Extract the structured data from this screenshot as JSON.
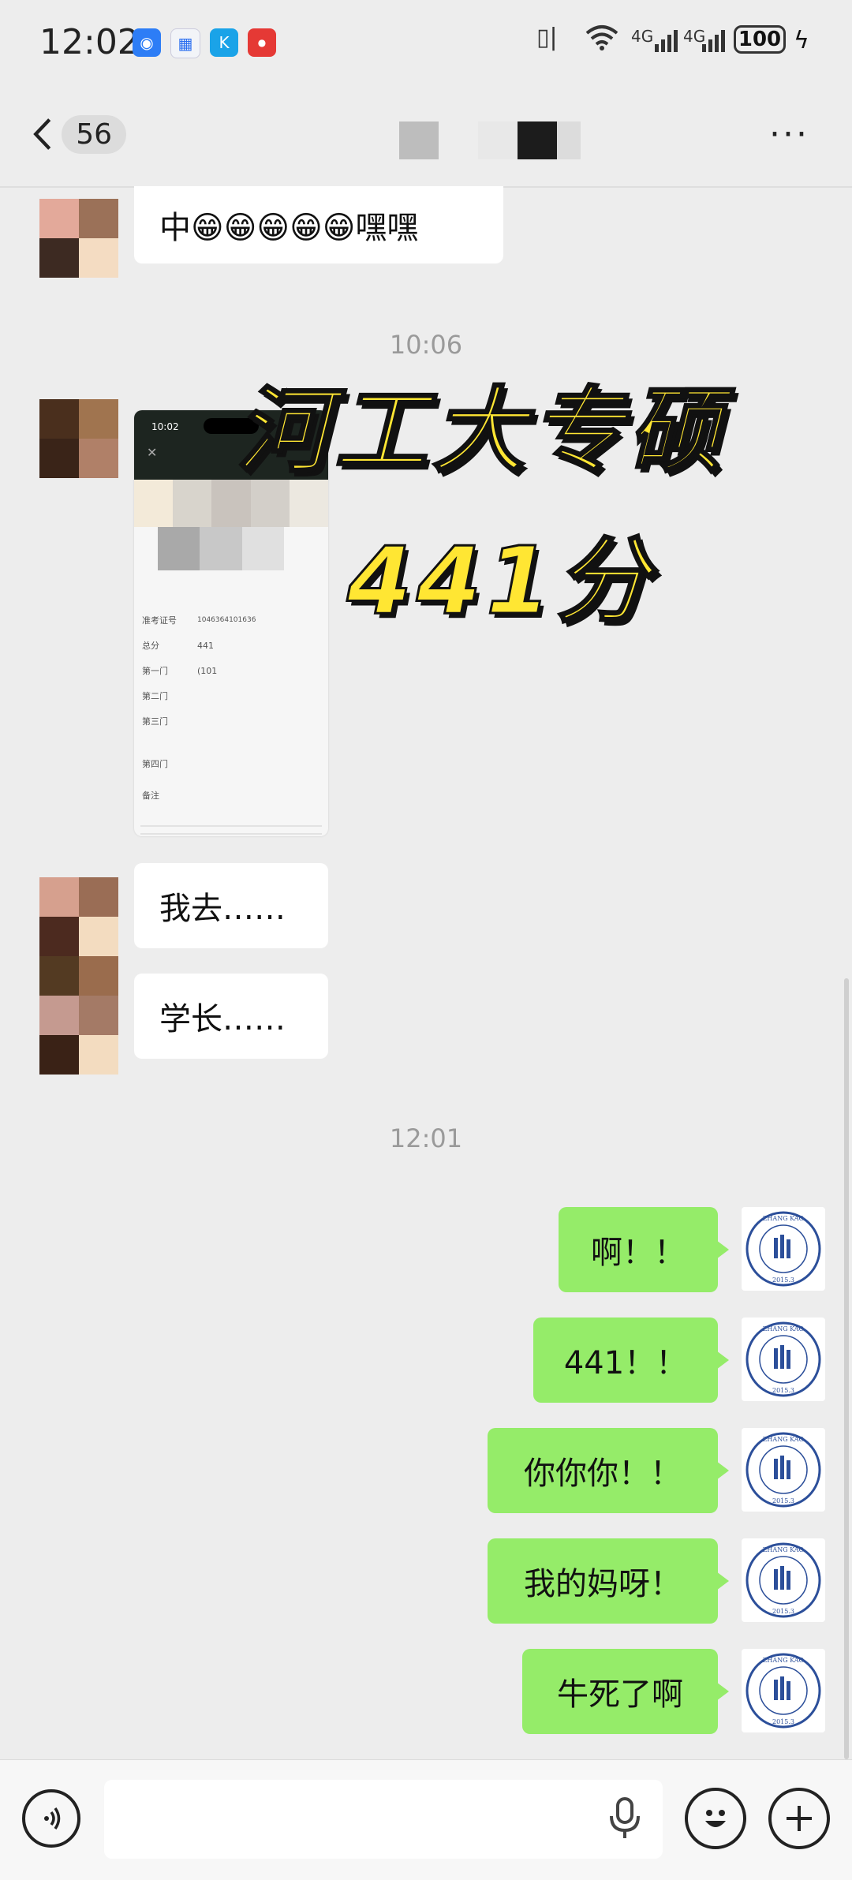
{
  "status_bar": {
    "time": "12:02",
    "network1": "4G",
    "network2": "4G",
    "battery": "100"
  },
  "nav": {
    "unread_count": "56",
    "more_label": "···"
  },
  "messages": {
    "m1": "中😁😁😁😁😁嘿嘿",
    "ts1": "10:06",
    "m3": "我去……",
    "m4": "学长……",
    "ts2": "12:01",
    "o1": "啊！！",
    "o2": "441！！",
    "o3": "你你你！！",
    "o4": "我的妈呀！",
    "o5": "牛死了啊"
  },
  "image_message": {
    "time": "10:02",
    "rows": [
      "准考证号",
      "总分",
      "第一门",
      "第二门",
      "第三门",
      "第四门",
      "备注"
    ],
    "id_value": "1046364101636",
    "total_value": "441",
    "first_value": "(101"
  },
  "overlay": {
    "line1": "河工大专硕",
    "line2": "441分"
  },
  "own_avatar": {
    "ring_text": "LUO XUE ZHANG KAO YAN",
    "year": "2015.3"
  },
  "colors": {
    "accent_green": "#95ec69",
    "background": "#ededed",
    "overlay_yellow": "#ffe633"
  },
  "icons": {
    "voice": "voice-icon",
    "mic": "mic-icon",
    "emoji": "emoji-icon",
    "plus": "plus-icon",
    "back": "chevron-left-icon"
  }
}
